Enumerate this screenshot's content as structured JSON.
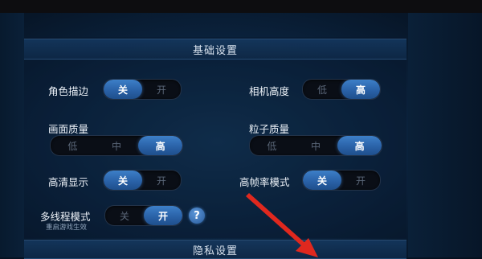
{
  "sections": {
    "basic_title": "基础设置",
    "privacy_title": "隐私设置"
  },
  "settings": {
    "outline": {
      "label": "角色描边",
      "options": [
        "关",
        "开"
      ],
      "selected": "关"
    },
    "camera_height": {
      "label": "相机高度",
      "options": [
        "低",
        "高"
      ],
      "selected": "高"
    },
    "graphics_quality": {
      "label": "画面质量",
      "options": [
        "低",
        "中",
        "高"
      ],
      "selected": "高"
    },
    "particle_quality": {
      "label": "粒子质量",
      "options": [
        "低",
        "中",
        "高"
      ],
      "selected": "高"
    },
    "hd_display": {
      "label": "高清显示",
      "options": [
        "关",
        "开"
      ],
      "selected": "关"
    },
    "high_fps": {
      "label": "高帧率模式",
      "options": [
        "关",
        "开"
      ],
      "selected": "关"
    },
    "multithread": {
      "label": "多线程模式",
      "sublabel": "重启游戏生效",
      "options": [
        "关",
        "开"
      ],
      "selected": "开"
    }
  },
  "help_icon": {
    "glyph": "?",
    "icon": "question-icon"
  },
  "colors": {
    "accent": "#2f6fb8",
    "annotation_arrow": "#e0281e"
  }
}
